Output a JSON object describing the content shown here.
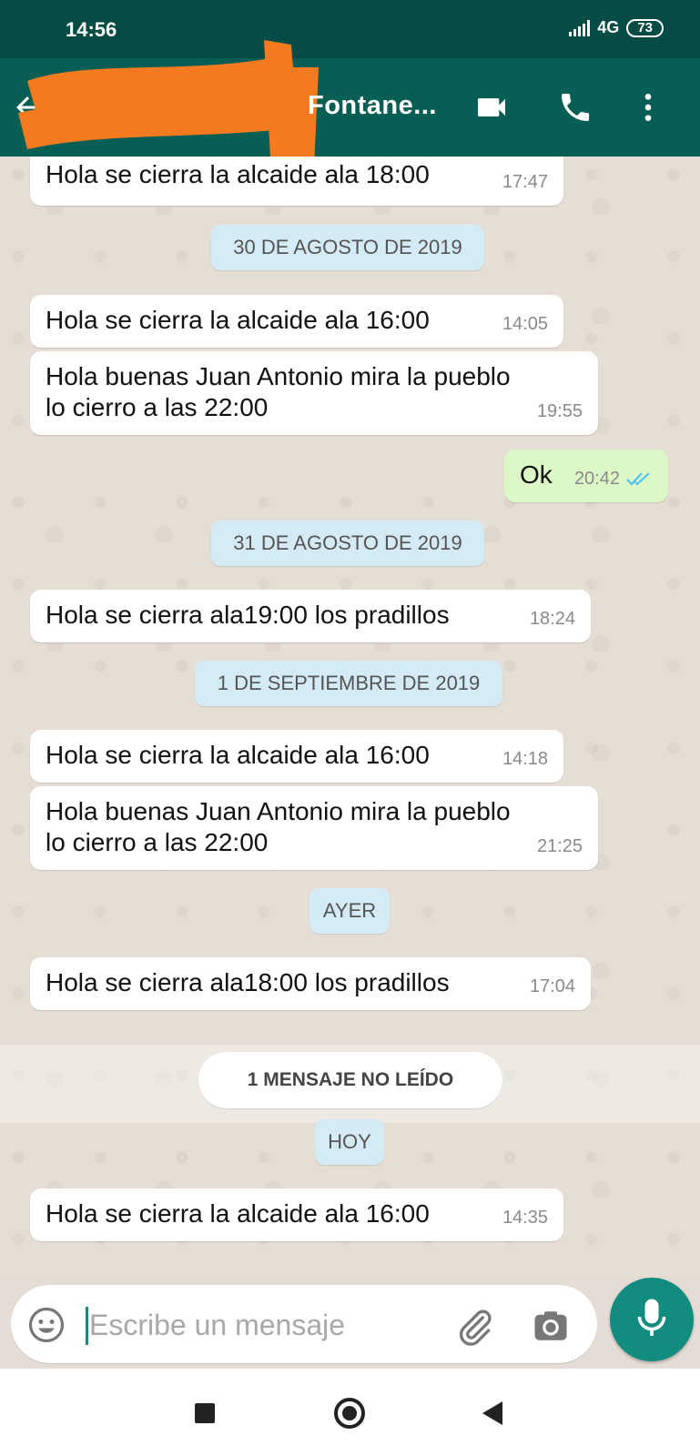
{
  "status_bar": {
    "time": "14:56",
    "network": "4G",
    "battery": "73"
  },
  "toolbar": {
    "contact_name": "Fontane..."
  },
  "messages": [
    {
      "text": "Hola se cierra la alcaide ala 18:00",
      "time": "17:47"
    },
    {
      "text": "Hola se cierra la alcaide ala 16:00",
      "time": "14:05"
    },
    {
      "text_line1": "Hola buenas Juan Antonio mira la pueblo",
      "text_line2": "lo cierro a las 22:00",
      "time": "19:55"
    },
    {
      "text": "Ok",
      "time": "20:42",
      "status": "read"
    },
    {
      "text": "Hola se cierra ala19:00 los pradillos",
      "time": "18:24"
    },
    {
      "text": "Hola se cierra la alcaide ala 16:00",
      "time": "14:18"
    },
    {
      "text_line1": "Hola buenas Juan Antonio mira la pueblo",
      "text_line2": "lo cierro a las 22:00",
      "time": "21:25"
    },
    {
      "text": "Hola se cierra ala18:00 los pradillos",
      "time": "17:04"
    },
    {
      "text": "Hola se cierra la alcaide ala 16:00",
      "time": "14:35"
    }
  ],
  "date_separators": [
    "30 DE AGOSTO DE 2019",
    "31 DE AGOSTO DE 2019",
    "1 DE SEPTIEMBRE DE 2019",
    "AYER",
    "HOY"
  ],
  "unread_banner": "1 MENSAJE NO LEÍDO",
  "composer": {
    "placeholder": "Escribe un mensaje"
  },
  "colors": {
    "header": "#075e54",
    "status_bar": "#054d44",
    "outgoing_bubble": "#dcf8c6",
    "incoming_bubble": "#ffffff",
    "date_pill": "#d4eaf4",
    "mic_button": "#128c7e",
    "read_ticks": "#4fc3f7"
  },
  "icons": [
    "back-arrow-icon",
    "video-call-icon",
    "phone-icon",
    "more-vert-icon",
    "emoji-icon",
    "attach-icon",
    "camera-icon",
    "mic-icon",
    "double-check-icon"
  ]
}
